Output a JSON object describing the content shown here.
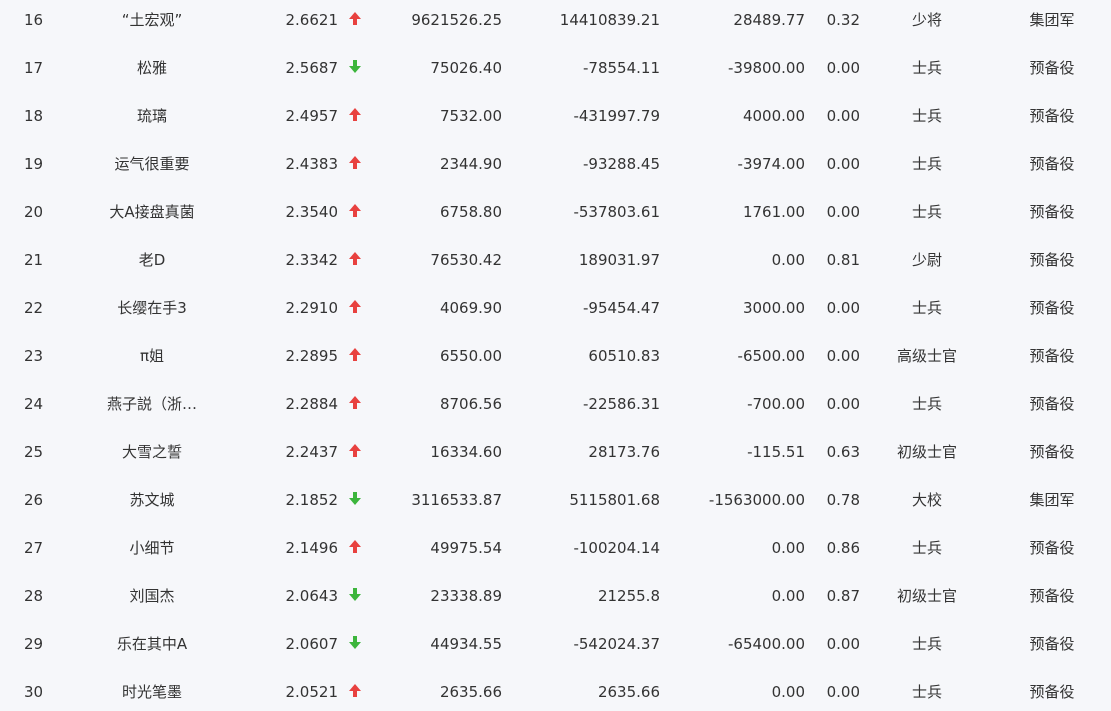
{
  "colors": {
    "up": "#e8413f",
    "down": "#3cb53c"
  },
  "rows": [
    {
      "rank": "16",
      "name": "“土宏观”",
      "score": "2.6621",
      "trend": "up",
      "v1": "9621526.25",
      "v2": "14410839.21",
      "v3": "28489.77",
      "ratio": "0.32",
      "title": "少将",
      "corps": "集团军"
    },
    {
      "rank": "17",
      "name": "松雅",
      "score": "2.5687",
      "trend": "down",
      "v1": "75026.40",
      "v2": "-78554.11",
      "v3": "-39800.00",
      "ratio": "0.00",
      "title": "士兵",
      "corps": "预备役"
    },
    {
      "rank": "18",
      "name": "琉璃",
      "score": "2.4957",
      "trend": "up",
      "v1": "7532.00",
      "v2": "-431997.79",
      "v3": "4000.00",
      "ratio": "0.00",
      "title": "士兵",
      "corps": "预备役"
    },
    {
      "rank": "19",
      "name": "运气很重要",
      "score": "2.4383",
      "trend": "up",
      "v1": "2344.90",
      "v2": "-93288.45",
      "v3": "-3974.00",
      "ratio": "0.00",
      "title": "士兵",
      "corps": "预备役"
    },
    {
      "rank": "20",
      "name": "大A接盘真菌",
      "score": "2.3540",
      "trend": "up",
      "v1": "6758.80",
      "v2": "-537803.61",
      "v3": "1761.00",
      "ratio": "0.00",
      "title": "士兵",
      "corps": "预备役"
    },
    {
      "rank": "21",
      "name": "老D",
      "score": "2.3342",
      "trend": "up",
      "v1": "76530.42",
      "v2": "189031.97",
      "v3": "0.00",
      "ratio": "0.81",
      "title": "少尉",
      "corps": "预备役"
    },
    {
      "rank": "22",
      "name": "长缨在手3",
      "score": "2.2910",
      "trend": "up",
      "v1": "4069.90",
      "v2": "-95454.47",
      "v3": "3000.00",
      "ratio": "0.00",
      "title": "士兵",
      "corps": "预备役"
    },
    {
      "rank": "23",
      "name": "π姐",
      "score": "2.2895",
      "trend": "up",
      "v1": "6550.00",
      "v2": "60510.83",
      "v3": "-6500.00",
      "ratio": "0.00",
      "title": "高级士官",
      "corps": "预备役"
    },
    {
      "rank": "24",
      "name": "燕子説（浙…",
      "score": "2.2884",
      "trend": "up",
      "v1": "8706.56",
      "v2": "-22586.31",
      "v3": "-700.00",
      "ratio": "0.00",
      "title": "士兵",
      "corps": "预备役"
    },
    {
      "rank": "25",
      "name": "大雪之誓",
      "score": "2.2437",
      "trend": "up",
      "v1": "16334.60",
      "v2": "28173.76",
      "v3": "-115.51",
      "ratio": "0.63",
      "title": "初级士官",
      "corps": "预备役"
    },
    {
      "rank": "26",
      "name": "苏文城",
      "score": "2.1852",
      "trend": "down",
      "v1": "3116533.87",
      "v2": "5115801.68",
      "v3": "-1563000.00",
      "ratio": "0.78",
      "title": "大校",
      "corps": "集团军"
    },
    {
      "rank": "27",
      "name": "小细节",
      "score": "2.1496",
      "trend": "up",
      "v1": "49975.54",
      "v2": "-100204.14",
      "v3": "0.00",
      "ratio": "0.86",
      "title": "士兵",
      "corps": "预备役"
    },
    {
      "rank": "28",
      "name": "刘国杰",
      "score": "2.0643",
      "trend": "down",
      "v1": "23338.89",
      "v2": "21255.8",
      "v3": "0.00",
      "ratio": "0.87",
      "title": "初级士官",
      "corps": "预备役"
    },
    {
      "rank": "29",
      "name": "乐在其中A",
      "score": "2.0607",
      "trend": "down",
      "v1": "44934.55",
      "v2": "-542024.37",
      "v3": "-65400.00",
      "ratio": "0.00",
      "title": "士兵",
      "corps": "预备役"
    },
    {
      "rank": "30",
      "name": "时光笔墨",
      "score": "2.0521",
      "trend": "up",
      "v1": "2635.66",
      "v2": "2635.66",
      "v3": "0.00",
      "ratio": "0.00",
      "title": "士兵",
      "corps": "预备役"
    }
  ]
}
